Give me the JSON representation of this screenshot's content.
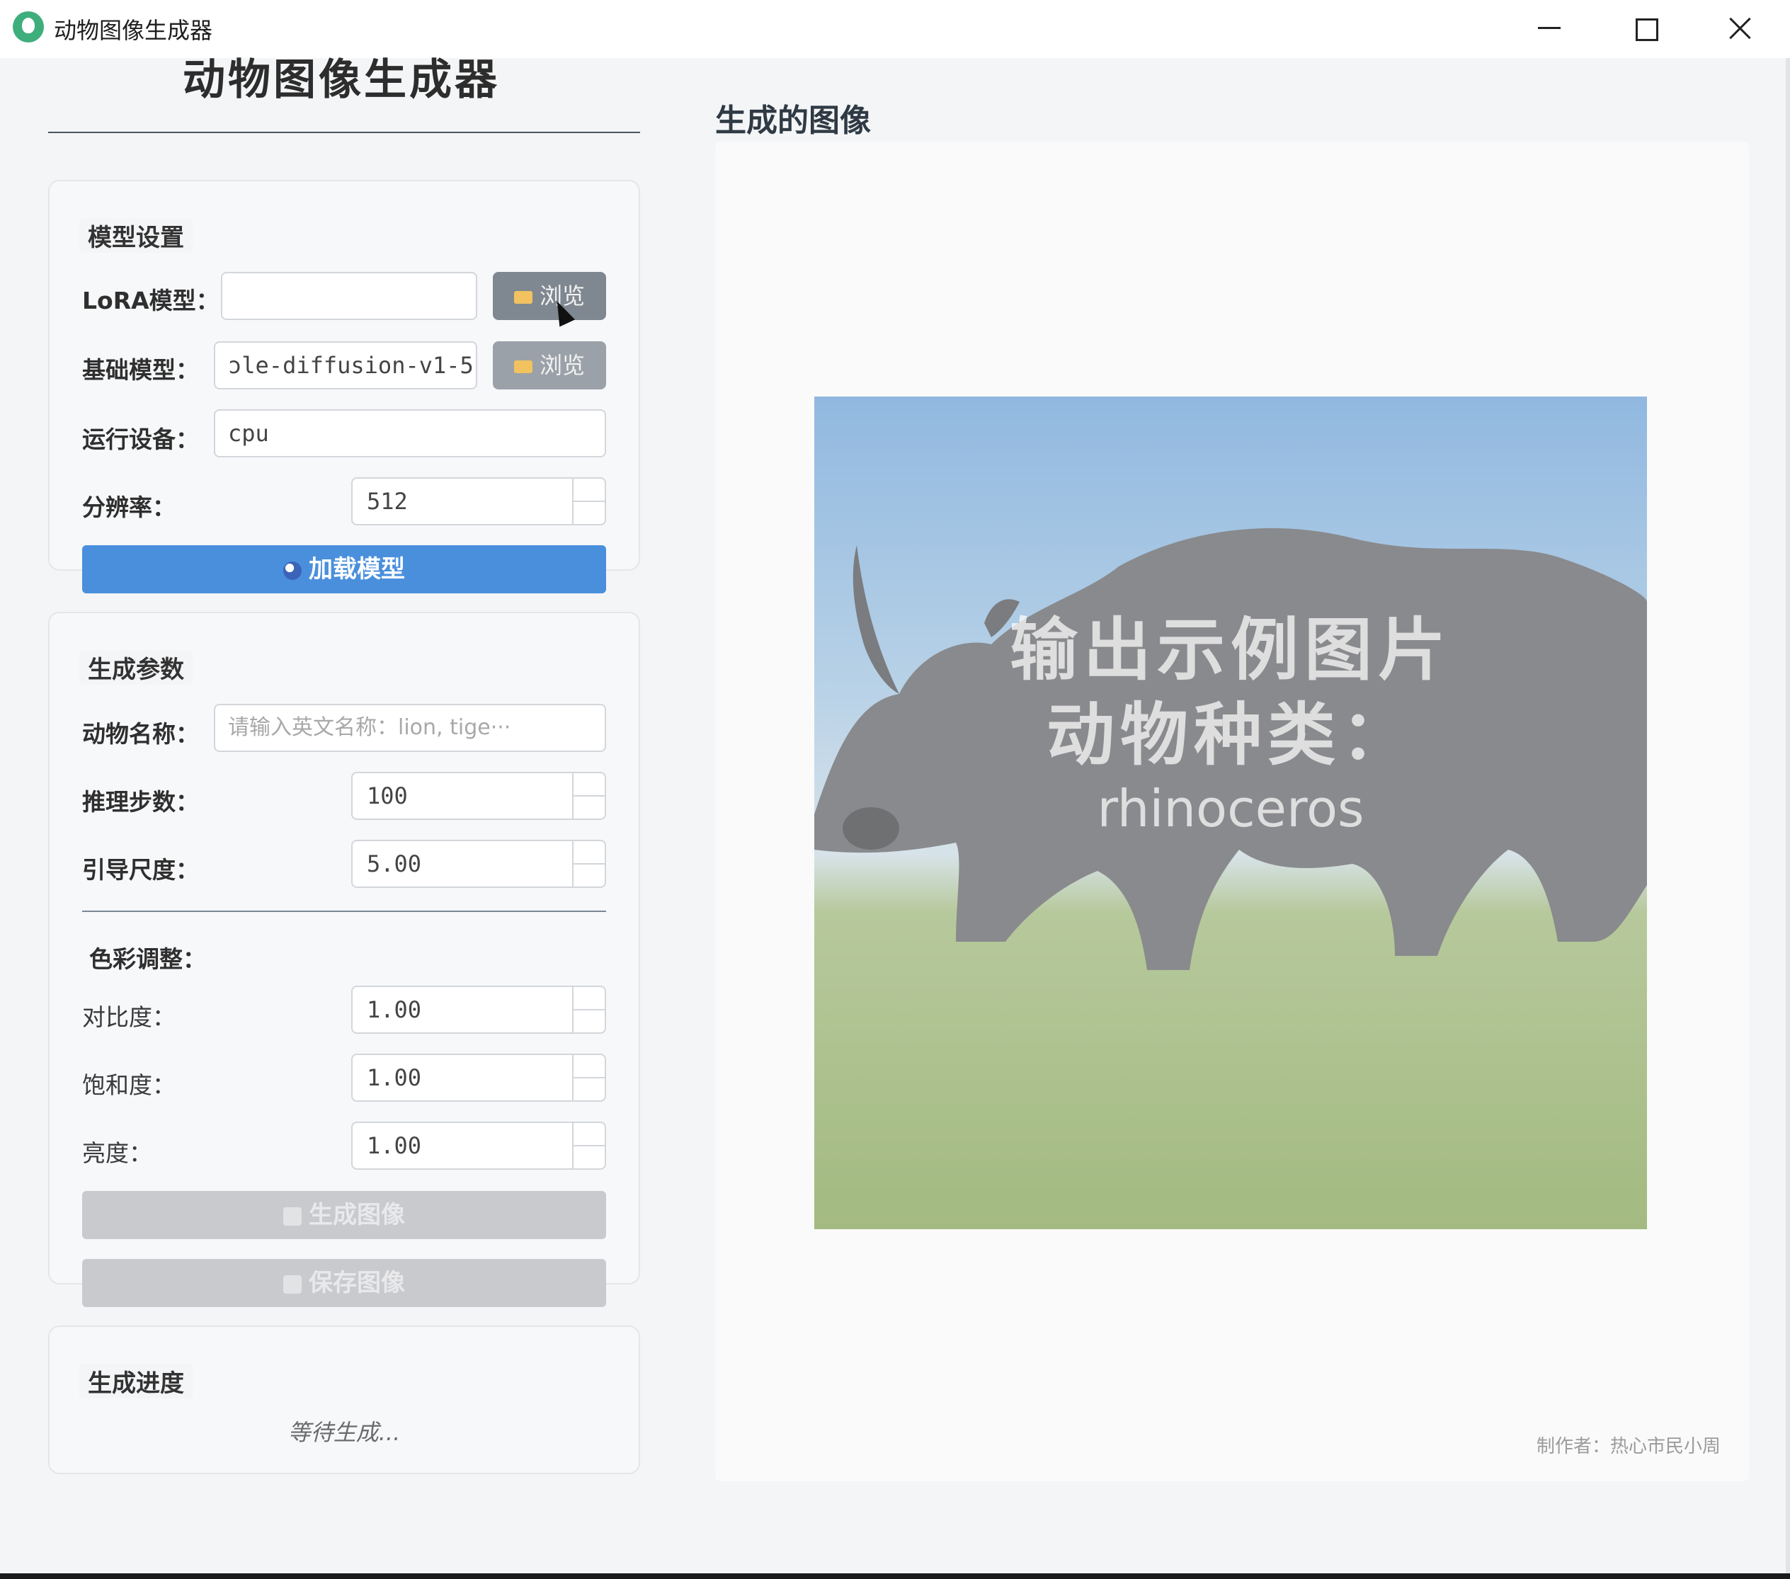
{
  "window": {
    "title": "动物图像生成器",
    "controls": [
      "minimize",
      "maximize",
      "close"
    ]
  },
  "app": {
    "heading": "动物图像生成器"
  },
  "model_settings": {
    "group_title": "模型设置",
    "lora_label": "LoRA模型：",
    "lora_value": "",
    "base_label": "基础模型：",
    "base_value": "ɔle-diffusion-v1-5",
    "browse_label": "浏览",
    "device_label": "运行设备：",
    "device_value": "cpu",
    "resolution_label": "分辨率：",
    "resolution_value": "512",
    "load_button": "加载模型"
  },
  "generation_params": {
    "group_title": "生成参数",
    "animal_label": "动物名称：",
    "animal_placeholder": "请输入英文名称：lion, tige···",
    "steps_label": "推理步数：",
    "steps_value": "100",
    "guidance_label": "引导尺度：",
    "guidance_value": "5.00",
    "color_title": "色彩调整：",
    "contrast_label": "对比度：",
    "contrast_value": "1.00",
    "saturation_label": "饱和度：",
    "saturation_value": "1.00",
    "brightness_label": "亮度：",
    "brightness_value": "1.00",
    "generate_button": "生成图像",
    "save_button": "保存图像"
  },
  "progress": {
    "group_title": "生成进度",
    "status": "等待生成..."
  },
  "output": {
    "title": "生成的图像",
    "watermark_line1": "输出示例图片",
    "watermark_line2": "动物种类：",
    "watermark_line3": "rhinoceros",
    "author": "制作者：热心市民小周"
  },
  "colors": {
    "primary_button": "#4a8fdc",
    "disabled_button": "#c8cace",
    "browse_button": "#7f8790",
    "background": "#f4f5f7"
  }
}
